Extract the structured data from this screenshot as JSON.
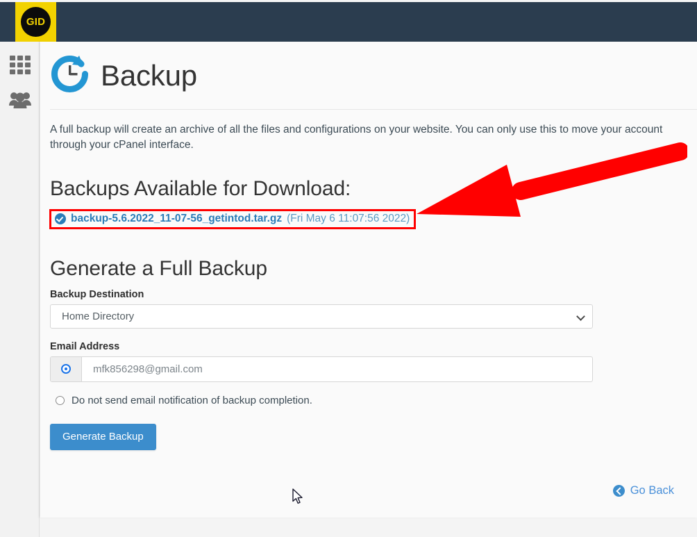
{
  "header": {
    "logo_text": "GID",
    "logo_bg": "#f2d200",
    "bar_bg": "#2b3d4f"
  },
  "sidebar": {
    "items": [
      {
        "icon": "apps-grid-icon",
        "name": "sidebar-item-apps"
      },
      {
        "icon": "users-group-icon",
        "name": "sidebar-item-users"
      }
    ]
  },
  "page": {
    "title": "Backup",
    "title_icon": "backup-restore-clock-icon",
    "intro": "A full backup will create an archive of all the files and configurations on your website. You can only use this to move your account\nthrough your cPanel interface."
  },
  "downloads": {
    "heading": "Backups Available for Download:",
    "file": {
      "icon": "check-circle-icon",
      "name": "backup-5.6.2022_11-07-56_getintod.tar.gz",
      "date": "(Fri May 6 11:07:56 2022)",
      "highlight_color": "#ff0000"
    }
  },
  "generate": {
    "heading": "Generate a Full Backup",
    "destination_label": "Backup Destination",
    "destination_value": "Home Directory",
    "destination_options": [
      "Home Directory"
    ],
    "email_label": "Email Address",
    "email_value": "mfk856298@gmail.com",
    "email_radio_selected": true,
    "no_email_label": "Do not send email notification of backup completion.",
    "submit_label": "Generate Backup",
    "submit_color": "#3c8dcc"
  },
  "footer": {
    "go_back_label": "Go Back",
    "go_back_icon": "arrow-left-circle-icon"
  },
  "annotation": {
    "arrow_color": "#ff0000",
    "points_to": "backup-5.6.2022_11-07-56_getintod.tar.gz"
  }
}
